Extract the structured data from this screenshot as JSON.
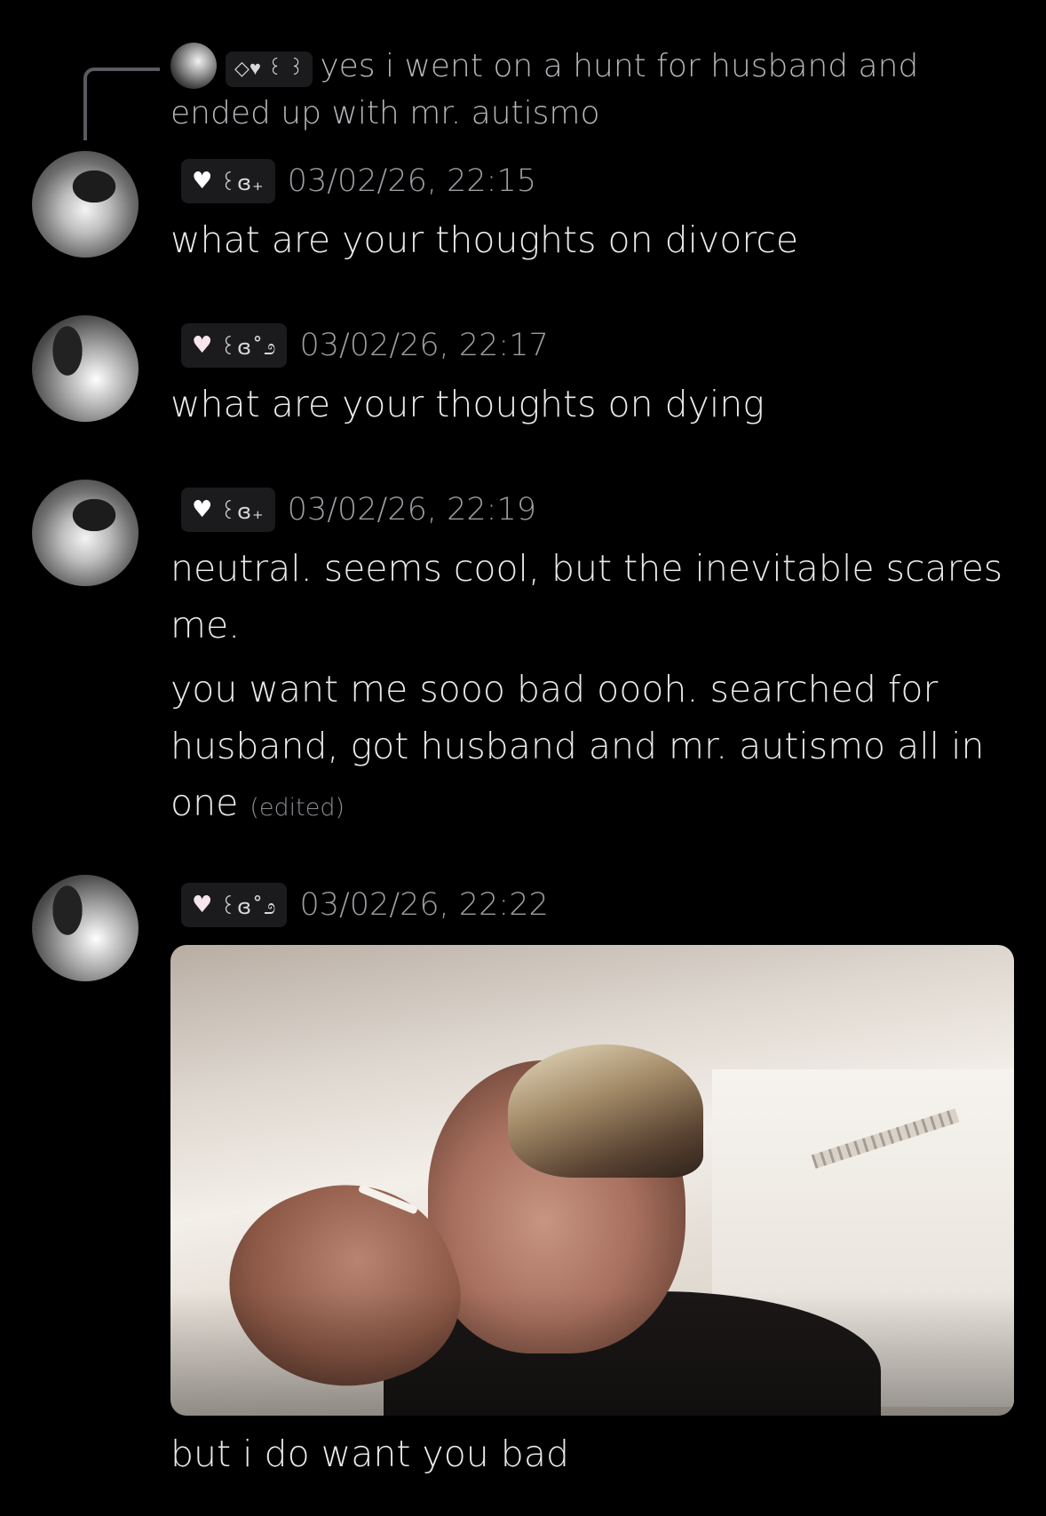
{
  "reply": {
    "username_tag": "◇♥ ꒰ ꒱",
    "text": "yes i went on a hunt for husband and ended up with mr. autismo"
  },
  "messages": [
    {
      "tag_heart": "♥",
      "tag_deco": "꒰ɞ₊",
      "timestamp": "03/02/26, 22:15",
      "lines": [
        "what are your thoughts on divorce"
      ]
    },
    {
      "tag_heart": "♥",
      "tag_deco": "꒰ɞ˚೨",
      "timestamp": "03/02/26, 22:17",
      "lines": [
        "what are your thoughts on dying"
      ]
    },
    {
      "tag_heart": "♥",
      "tag_deco": "꒰ɞ₊",
      "timestamp": "03/02/26, 22:19",
      "lines": [
        "neutral. seems cool, but the inevitable scares me.",
        "you want me sooo bad oooh. searched for husband, got husband and mr. autismo all in one"
      ],
      "edited_label": "(edited)"
    },
    {
      "tag_heart": "♥",
      "tag_deco": "꒰ɞ˚೨",
      "timestamp": "03/02/26, 22:22",
      "caption": "but i do want you bad"
    }
  ]
}
